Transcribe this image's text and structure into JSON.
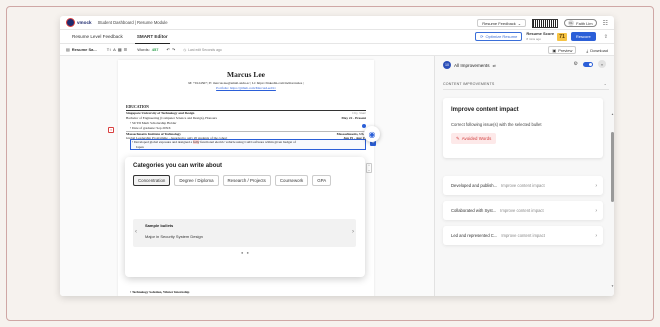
{
  "topbar": {
    "logo_text": "vmock",
    "breadcrumb": "Student Dashboard | Resume Module",
    "feedback_select": "Resume Feedback",
    "user_initials": "FL",
    "user_name": "Faith Lim"
  },
  "tabs": [
    {
      "label": "Resume Level Feedback",
      "active": false
    },
    {
      "label": "SMART Editor",
      "active": true
    }
  ],
  "tabs_right": {
    "optimize_label": "Optimize Resume",
    "score_label": "Resume Score",
    "score_sub": "8 mins ago",
    "score_value": "71",
    "rescore_label": "Rescore"
  },
  "toolbar": {
    "file_name": "Resume Sa...",
    "words_label": "Words:",
    "words_count": "457",
    "saved_text": "Last edit Seconds ago",
    "preview_label": "Preview",
    "download_label": "Download"
  },
  "resume": {
    "name": "Marcus Lee",
    "contact1": "M: +9124567 | E: marcus.lee@email.andu.ac | Li: https://linkedin.com/in/marcuslee |",
    "contact2": "Portfolio: https://github.com/MarcusLee011",
    "section_education": "EDUCATION",
    "school1": "Singapore University of Technology and Design",
    "school1_loc": "City, State",
    "degree1": "Bachelor of Engineering (Computer Science and Design), Honours",
    "degree1_date": "May 22 - Present",
    "bullet1": "SUTD Merit Scholarship Holder",
    "bullet2": "Date of graduate: Sep 20XX",
    "school2": "Massachusetts Institute of Technology",
    "school2_loc": "Massachusetts, USA",
    "program2": "Global Leadership Programme - Awarded to only 20 students of the cohort",
    "program2_date": "Jun 19 - Aug 19",
    "bullet3_a": "Developed global exposure and designed a ",
    "bullet3_hl": "fully",
    "bullet3_b": " functional electric vehicle using CAD software within given budget of",
    "bullet3_c": "Japan",
    "bottom_bullet": "Technology Solution, Winter Internship",
    "side_mark": "T"
  },
  "popup": {
    "title": "Categories you can write about",
    "chips": [
      {
        "label": "Concentration",
        "active": true
      },
      {
        "label": "Degree / Diploma",
        "active": false
      },
      {
        "label": "Research / Projects",
        "active": false
      },
      {
        "label": "Coursework",
        "active": false
      },
      {
        "label": "GPA",
        "active": false
      }
    ],
    "sample_title": "Sample bullets",
    "sample_text": "Major in Security System Design"
  },
  "panel": {
    "badge_count": "10",
    "heading": "All Improvements",
    "subheading": "CONTENT IMPROVEMENTS",
    "main_card": {
      "title": "Improve content impact",
      "desc": "Correct following issue(s) with the selected bullet",
      "tag": "Avoided Words"
    },
    "rows": [
      {
        "left": "Developed and publish...",
        "right": "Improve content impact"
      },
      {
        "left": "Collaborated with Syst...",
        "right": "Improve content impact"
      },
      {
        "left": "Led and represented C...",
        "right": "Improve content impact"
      }
    ]
  },
  "colors": {
    "accent": "#2b5fd8",
    "score": "#f6c343",
    "danger": "#d13a3a"
  }
}
